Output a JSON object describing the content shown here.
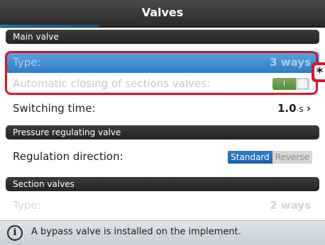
{
  "window": {
    "title": "Valves"
  },
  "main_valve": {
    "header": "Main valve",
    "type": {
      "label": "Type:",
      "value": "3 ways"
    },
    "auto_closing": {
      "label": "Automatic closing of sections valves:",
      "toggle_text": "I",
      "state": "on"
    },
    "switching_time": {
      "label": "Switching time:",
      "value": "1.0",
      "unit": "s",
      "chevron": "›"
    }
  },
  "pressure_valve": {
    "header": "Pressure regulating valve",
    "regulation": {
      "label": "Regulation direction:",
      "options": [
        "Standard",
        "Reverse"
      ],
      "selected": "Standard"
    }
  },
  "section_valves": {
    "header": "Section valves",
    "type": {
      "label": "Type:",
      "value": "2 ways"
    }
  },
  "info": {
    "icon": "info-icon",
    "glyph": "i",
    "message": "A bypass valve is installed on the implement."
  },
  "marker": {
    "symbol": "*"
  },
  "colors": {
    "accent": "#2f7bc2",
    "highlight": "#d8162c",
    "toggle_on": "#6a9a4a"
  }
}
